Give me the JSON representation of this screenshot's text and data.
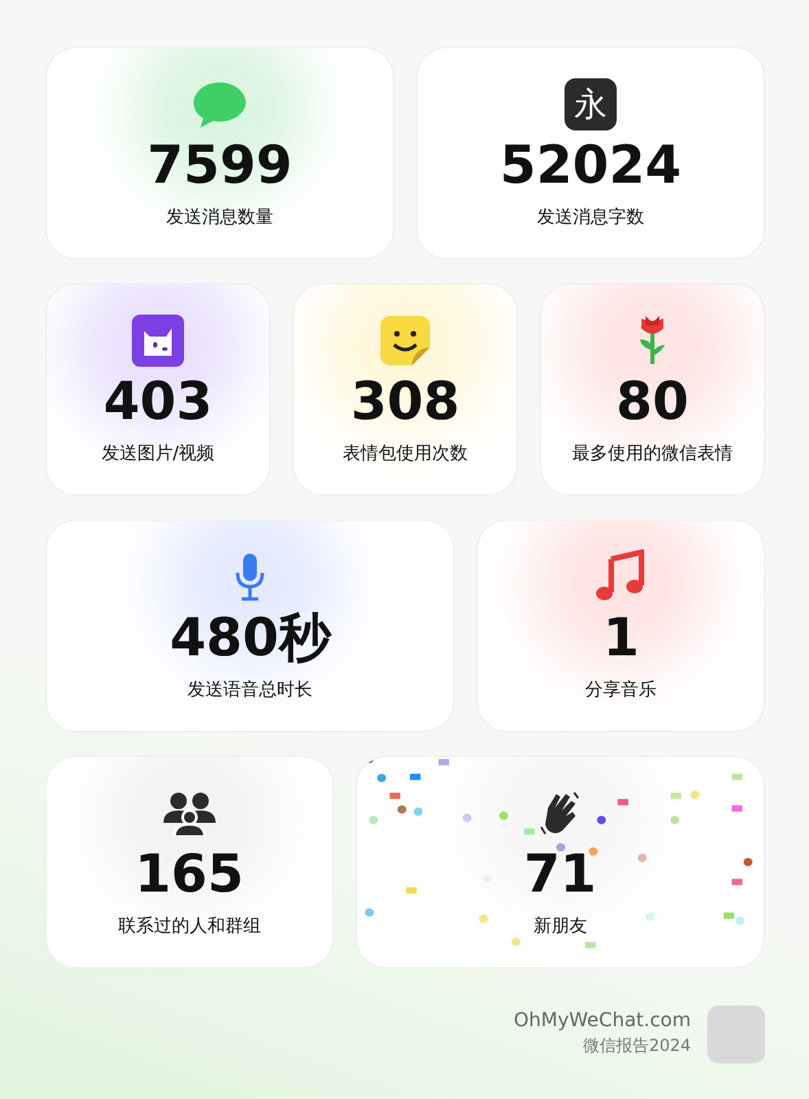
{
  "rows": [
    {
      "cards": [
        {
          "kind": "chat",
          "value": "7599",
          "label": "发送消息数量"
        },
        {
          "kind": "glyph",
          "glyph": "永",
          "value": "52024",
          "label": "发送消息字数"
        }
      ]
    },
    {
      "cards": [
        {
          "kind": "photo",
          "value": "403",
          "label": "发送图片/视频"
        },
        {
          "kind": "sticker",
          "value": "308",
          "label": "表情包使用次数"
        },
        {
          "kind": "rose",
          "value": "80",
          "label": "最多使用的微信表情"
        }
      ]
    },
    {
      "cards": [
        {
          "kind": "mic",
          "value": "480秒",
          "label": "发送语音总时长"
        },
        {
          "kind": "music",
          "value": "1",
          "label": "分享音乐"
        }
      ]
    },
    {
      "cards": [
        {
          "kind": "people",
          "value": "165",
          "label": "联系过的人和群组"
        },
        {
          "kind": "wave",
          "value": "71",
          "label": "新朋友",
          "confetti": true
        }
      ]
    }
  ],
  "footer": {
    "site": "OhMyWeChat.com",
    "subtitle": "微信报告2024"
  }
}
